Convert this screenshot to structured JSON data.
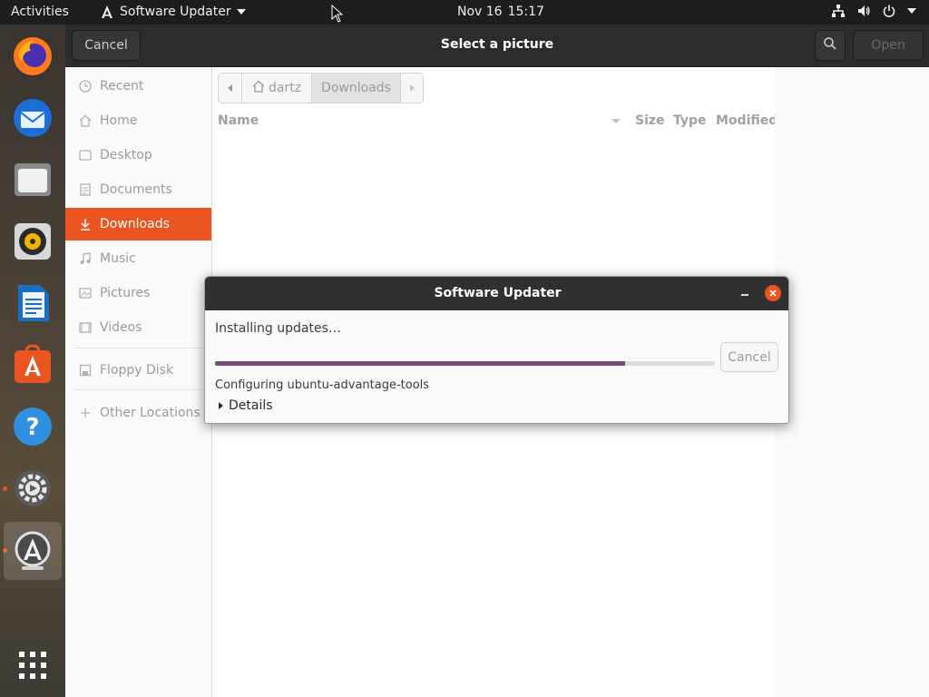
{
  "topbar": {
    "activities": "Activities",
    "app_name": "Software Updater",
    "date": "Nov 16",
    "time": "15:17",
    "icons": [
      "network-icon",
      "volume-icon",
      "power-icon",
      "system-menu-chevron-icon"
    ]
  },
  "dock": {
    "apps": [
      "firefox-icon",
      "thunderbird-icon",
      "files-icon",
      "rhythmbox-icon",
      "libreoffice-writer-icon",
      "ubuntu-software-icon",
      "help-icon",
      "settings-icon",
      "software-updater-icon",
      "show-applications-icon"
    ]
  },
  "chooser": {
    "title": "Select a picture",
    "cancel_label": "Cancel",
    "open_label": "Open",
    "sidebar": [
      {
        "label": "Recent",
        "icon": "clock-icon"
      },
      {
        "label": "Home",
        "icon": "home-icon"
      },
      {
        "label": "Desktop",
        "icon": "desktop-folder-icon"
      },
      {
        "label": "Documents",
        "icon": "documents-icon"
      },
      {
        "label": "Downloads",
        "icon": "download-icon",
        "active": true
      },
      {
        "label": "Music",
        "icon": "music-icon"
      },
      {
        "label": "Pictures",
        "icon": "pictures-icon"
      },
      {
        "label": "Videos",
        "icon": "videos-icon"
      },
      {
        "label": "Floppy Disk",
        "icon": "floppy-icon"
      },
      {
        "label": "Other Locations",
        "icon": "plus-icon"
      }
    ],
    "path": {
      "home": "dartz",
      "current": "Downloads"
    },
    "columns": {
      "name": "Name",
      "size": "Size",
      "type": "Type",
      "modified": "Modified"
    }
  },
  "dialog": {
    "title": "Software Updater",
    "label": "Installing updates…",
    "progress_fraction": 0.82,
    "cancel_label": "Cancel",
    "status": "Configuring ubuntu-advantage-tools",
    "details_label": "Details"
  },
  "colors": {
    "accent": "#e95420",
    "progress": "#7a4a7a",
    "headerbar": "#2c2c2c"
  }
}
